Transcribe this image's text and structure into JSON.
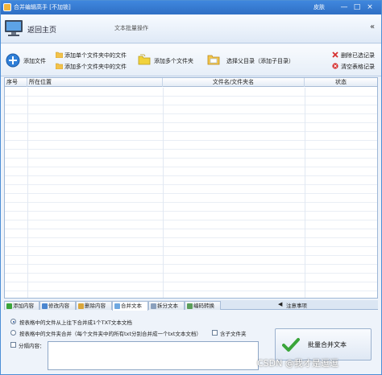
{
  "window": {
    "title": "合并编辑高手 [不加锁]",
    "skin_label": "皮肤",
    "controls": [
      "—",
      "□",
      "×"
    ]
  },
  "header": {
    "home_label": "返回主页",
    "subtitle": "文本批量操作",
    "collapse_glyph": "«"
  },
  "toolbar": {
    "add_file": "添加文件",
    "add_single_folder": "添加单个文件夹中的文件",
    "add_multi_folder": "添加多个文件夹中的文件",
    "add_multi_folders": "添加多个文件夹",
    "select_parent": "选择父目录（添加子目录）",
    "delete_selected": "删除已选记录",
    "clear_table": "清空表格记录"
  },
  "table": {
    "columns": [
      "序号",
      "所在位置",
      "文件名/文件夹名",
      "状态"
    ],
    "rows": []
  },
  "tabs": {
    "items": [
      "添加内容",
      "修改内容",
      "删除内容",
      "合并文本",
      "拆分文本",
      "编码转换"
    ],
    "active": "合并文本",
    "notes_label": "注意事项"
  },
  "merge_panel": {
    "option_1": "按表格中的文件从上往下合并成1个TXT文本文档",
    "option_2": "按表格中的文件夹合并（每个文件夹中的所有txt分别合并成一个txt文本文档）",
    "include_subfolders": "含子文件夹",
    "separator_label": "分隔内容：",
    "separator_value": "",
    "merge_button": "批量合并文本"
  },
  "watermark": "CSDN @我才是逗逗",
  "colors": {
    "titlebar": "#2f6fc4",
    "accent": "#4d8fd6",
    "check_green": "#3aa53a"
  }
}
